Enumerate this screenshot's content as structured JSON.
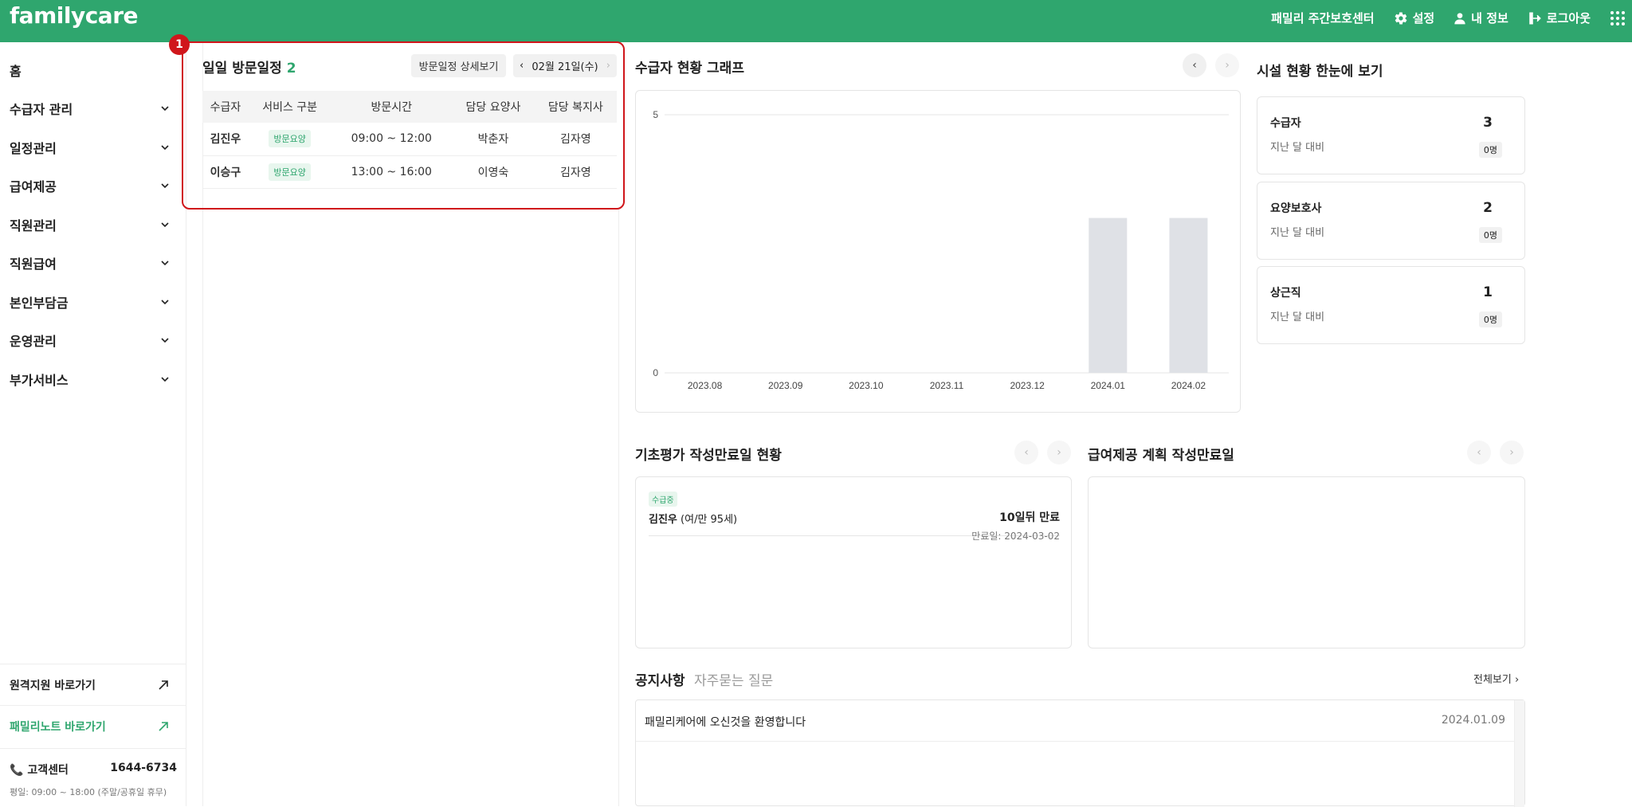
{
  "header": {
    "logo": "familycare",
    "center_name": "패밀리 주간보호센터",
    "settings_label": "설정",
    "myinfo_label": "내 정보",
    "logout_label": "로그아웃",
    "brand_color": "#2fa66e"
  },
  "sidebar": {
    "items": [
      {
        "label": "홈",
        "has_chevron": false
      },
      {
        "label": "수급자 관리",
        "has_chevron": true
      },
      {
        "label": "일정관리",
        "has_chevron": true
      },
      {
        "label": "급여제공",
        "has_chevron": true
      },
      {
        "label": "직원관리",
        "has_chevron": true
      },
      {
        "label": "직원급여",
        "has_chevron": true
      },
      {
        "label": "본인부담금",
        "has_chevron": true
      },
      {
        "label": "운영관리",
        "has_chevron": true
      },
      {
        "label": "부가서비스",
        "has_chevron": true
      }
    ],
    "remote_label": "원격지원 바로가기",
    "familynote_label": "패밀리노트 바로가기",
    "cs_label": "고객센터",
    "cs_phone": "1644-6734",
    "cs_hours": "평일: 09:00 ~ 18:00 (주말/공휴일 휴무)"
  },
  "visit": {
    "badge": "1",
    "title": "일일 방문일정",
    "count": "2",
    "detail_button": "방문일정 상세보기",
    "date": "02월 21일(수)",
    "columns": [
      "수급자",
      "서비스 구분",
      "방문시간",
      "담당 요양사",
      "담당 복지사"
    ],
    "rows": [
      {
        "name": "김진우",
        "service": "방문요양",
        "time": "09:00 ~ 12:00",
        "caregiver": "박춘자",
        "welfare": "김자영"
      },
      {
        "name": "이승구",
        "service": "방문요양",
        "time": "13:00 ~ 16:00",
        "caregiver": "이영숙",
        "welfare": "김자영"
      }
    ]
  },
  "graph": {
    "title": "수급자 현황 그래프"
  },
  "chart_data": {
    "type": "bar",
    "categories": [
      "2023.08",
      "2023.09",
      "2023.10",
      "2023.11",
      "2023.12",
      "2024.01",
      "2024.02"
    ],
    "values": [
      0,
      0,
      0,
      0,
      0,
      3,
      3
    ],
    "ylim": [
      0,
      5
    ],
    "yticks": [
      "0",
      "5"
    ],
    "bar_color": "#dfe1e6",
    "grid": true
  },
  "facility": {
    "title": "시설 현황 한눈에 보기",
    "cards": [
      {
        "label": "수급자",
        "sub": "지난 달 대비",
        "value": "3",
        "delta": "0명"
      },
      {
        "label": "요양보호사",
        "sub": "지난 달 대비",
        "value": "2",
        "delta": "0명"
      },
      {
        "label": "상근직",
        "sub": "지난 달 대비",
        "value": "1",
        "delta": "0명"
      }
    ]
  },
  "eval": {
    "title": "기초평가 작성만료일 현황",
    "status": "수급중",
    "name": "김진우",
    "detail": "(여/만 95세)",
    "remaining": "10일뒤 만료",
    "expiry": "만료일: 2024-03-02"
  },
  "plan": {
    "title": "급여제공 계획 작성만료일"
  },
  "notice": {
    "tab_notice": "공지사항",
    "tab_faq": "자주묻는 질문",
    "view_all": "전체보기",
    "items": [
      {
        "text": "패밀리케어에 오신것을 환영합니다",
        "date": "2024.01.09"
      }
    ]
  }
}
